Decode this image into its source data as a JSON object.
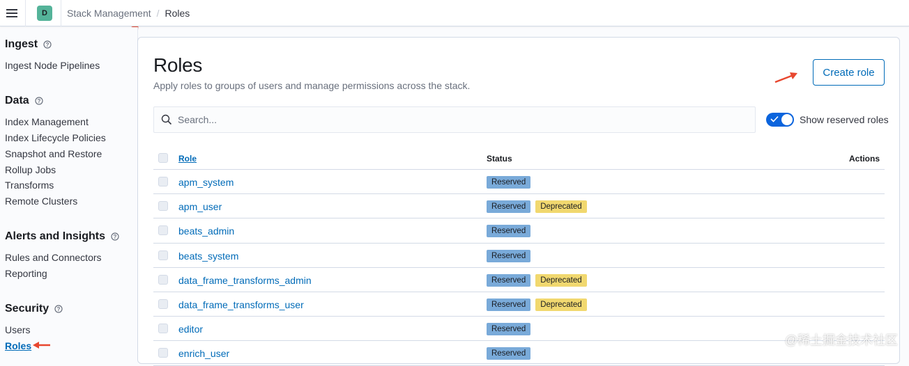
{
  "colors": {
    "accent": "#006bb8",
    "space_avatar_bg": "#54b399",
    "reserved_badge": "#79aad9",
    "deprecated_badge": "#f1d86f",
    "toggle_on": "#0b64dd",
    "annotation_arrow": "#e8472f"
  },
  "header": {
    "space_initial": "D",
    "breadcrumbs": {
      "parent": "Stack Management",
      "current": "Roles"
    }
  },
  "sidebar": {
    "sections": [
      {
        "title": "Ingest",
        "items": [
          "Ingest Node Pipelines"
        ]
      },
      {
        "title": "Data",
        "items": [
          "Index Management",
          "Index Lifecycle Policies",
          "Snapshot and Restore",
          "Rollup Jobs",
          "Transforms",
          "Remote Clusters"
        ]
      },
      {
        "title": "Alerts and Insights",
        "items": [
          "Rules and Connectors",
          "Reporting"
        ]
      },
      {
        "title": "Security",
        "items": [
          "Users",
          "Roles"
        ]
      }
    ],
    "active_item": "Roles"
  },
  "main": {
    "title": "Roles",
    "subtitle": "Apply roles to groups of users and manage permissions across the stack.",
    "create_button": "Create role",
    "search_placeholder": "Search...",
    "toggle_label": "Show reserved roles",
    "toggle_on": true
  },
  "table": {
    "columns": {
      "role": "Role",
      "status": "Status",
      "actions": "Actions"
    },
    "rows": [
      {
        "role": "apm_system",
        "badges": [
          "Reserved"
        ]
      },
      {
        "role": "apm_user",
        "badges": [
          "Reserved",
          "Deprecated"
        ]
      },
      {
        "role": "beats_admin",
        "badges": [
          "Reserved"
        ]
      },
      {
        "role": "beats_system",
        "badges": [
          "Reserved"
        ]
      },
      {
        "role": "data_frame_transforms_admin",
        "badges": [
          "Reserved",
          "Deprecated"
        ]
      },
      {
        "role": "data_frame_transforms_user",
        "badges": [
          "Reserved",
          "Deprecated"
        ]
      },
      {
        "role": "editor",
        "badges": [
          "Reserved"
        ]
      },
      {
        "role": "enrich_user",
        "badges": [
          "Reserved"
        ]
      }
    ]
  },
  "watermark": "@稀土掘金技术社区"
}
